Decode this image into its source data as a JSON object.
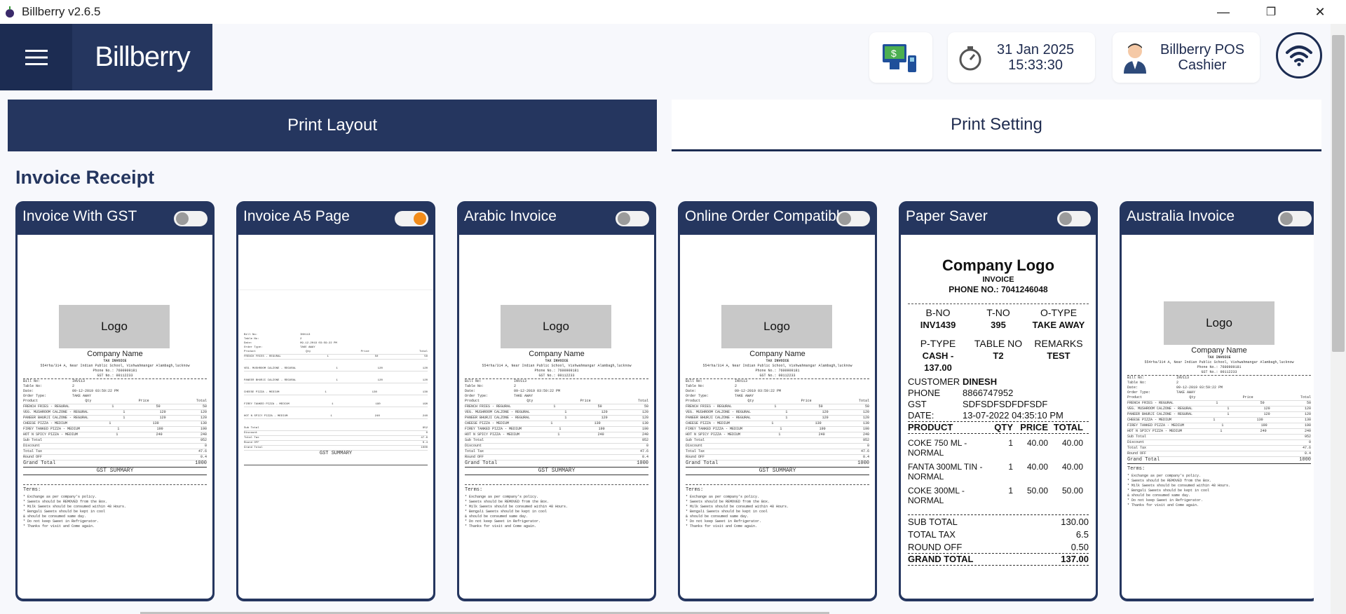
{
  "window": {
    "title": "Billberry v2.6.5",
    "minimize": "—",
    "maximize": "❐",
    "close": "✕"
  },
  "header": {
    "logo": "Billberry",
    "datetime": {
      "date": "31 Jan 2025",
      "time": "15:33:30"
    },
    "user": {
      "name": "Billberry POS",
      "role": "Cashier"
    }
  },
  "tabs": [
    {
      "label": "Print Layout",
      "active": true
    },
    {
      "label": "Print Setting",
      "active": false
    }
  ],
  "section_title": "Invoice Receipt",
  "cards": [
    {
      "title": "Invoice With GST",
      "enabled": false
    },
    {
      "title": "Invoice A5 Page",
      "enabled": true
    },
    {
      "title": "Arabic Invoice",
      "enabled": false
    },
    {
      "title": "Online Order Compatible",
      "enabled": false
    },
    {
      "title": "Paper Saver",
      "enabled": false
    },
    {
      "title": "Australia Invoice",
      "enabled": false
    }
  ],
  "preview": {
    "logo": "Logo",
    "company": "Company Name",
    "tax_invoice": "TAX INVOICE",
    "address": "554rha/314 A, Near Indian Public School, Vishwahmangar Alambagh,lucknow",
    "phone": "Phone No.: 7600909181",
    "gst": "GST No.: 00112233",
    "meta": [
      [
        "Bill No:",
        "INV113"
      ],
      [
        "Table No:",
        "2"
      ],
      [
        "Date:",
        "09-12-2019 03:59:22 PM"
      ],
      [
        "Order Type:",
        "TAKE AWAY"
      ]
    ],
    "items_header": [
      "Product",
      "Qty",
      "Price",
      "Total"
    ],
    "items": [
      [
        "FRENCH FRIES - REGURAL",
        "1",
        "50",
        "50"
      ],
      [
        "VEG. MUSHROOM CALZONE - REGURAL",
        "1",
        "120",
        "120"
      ],
      [
        "PANEER BHURJI CALZONE - REGURAL",
        "1",
        "120",
        "120"
      ],
      [
        "CHEESE PIZZA - MEDIUM",
        "1",
        "130",
        "130"
      ],
      [
        "FIREY TANKED PIZZA - MEDIUM",
        "1",
        "190",
        "190"
      ],
      [
        "HOT N SPICY PIZZA - MEDIUM",
        "1",
        "240",
        "240"
      ]
    ],
    "totals": [
      [
        "Sub Total",
        "952"
      ],
      [
        "Discount",
        "0"
      ],
      [
        "Total Tax",
        "47.6"
      ],
      [
        "Round OFF",
        "0.4"
      ]
    ],
    "grand": [
      "Grand Total",
      "1000"
    ],
    "gst_summary": "GST SUMMARY",
    "terms_title": "Terms:",
    "terms": [
      "* Exchange as per company's policy.",
      "* Sweets should be REMOVED from the Box.",
      "* Milk Sweets should be consumed within 48 Hours.",
      "* Bengali Sweets should be kept in cool",
      "& should be consumed same day.",
      "* Do not keep Sweet in Refrigerator.",
      "* Thanks for visit and Come again."
    ]
  },
  "paper_saver": {
    "logo": "Company Logo",
    "invoice": "INVOICE",
    "phone": "PHONE NO.: 7041246048",
    "h1": [
      "B-NO",
      "T-NO",
      "O-TYPE"
    ],
    "v1": [
      "INV1439",
      "395",
      "TAKE AWAY"
    ],
    "h2": [
      "P-TYPE",
      "TABLE NO",
      "REMARKS"
    ],
    "v2": [
      "CASH - 137.00",
      "T2",
      "TEST"
    ],
    "customer": [
      [
        "CUSTOMER",
        "DINESH"
      ],
      [
        "PHONE",
        "8866747952"
      ],
      [
        "GST",
        "SDFSDFSDFDFSDF"
      ],
      [
        "DATE:",
        "13-07-2022 04:35:10 PM"
      ]
    ],
    "cols": [
      "PRODUCT",
      "QTY",
      "PRICE",
      "TOTAL"
    ],
    "items": [
      [
        "COKE 750 ML - NORMAL",
        "1",
        "40.00",
        "40.00"
      ],
      [
        "FANTA 300ML TIN - NORMAL",
        "1",
        "40.00",
        "40.00"
      ],
      [
        "COKE 300ML - NORMAL",
        "1",
        "50.00",
        "50.00"
      ]
    ],
    "totals": [
      [
        "SUB TOTAL",
        "130.00"
      ],
      [
        "TOTAL TAX",
        "6.5"
      ],
      [
        "ROUND OFF",
        "0.50"
      ]
    ],
    "grand": [
      "GRAND TOTAL",
      "137.00"
    ]
  },
  "colors": {
    "navy": "#25365f",
    "accent_toggle": "#f28c1a"
  }
}
